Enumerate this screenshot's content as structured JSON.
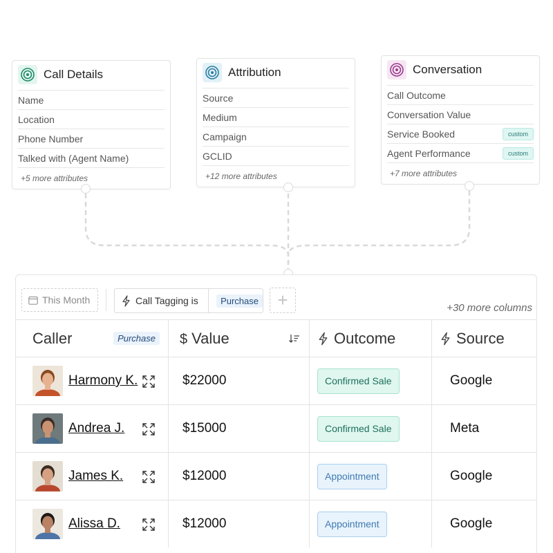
{
  "cards": [
    {
      "title": "Call Details",
      "icon": "target-icon",
      "icon_color": "#1f8a6a",
      "icon_bg": "#e3f6ee",
      "rows": [
        "Name",
        "Location",
        "Phone Number",
        "Talked with (Agent Name)"
      ],
      "more": "+5 more attributes"
    },
    {
      "title": "Attribution",
      "icon": "target-icon",
      "icon_color": "#2c7da0",
      "icon_bg": "#e1f1f8",
      "rows": [
        "Source",
        "Medium",
        "Campaign",
        "GCLID"
      ],
      "more": "+12 more attributes"
    },
    {
      "title": "Conversation",
      "icon": "target-icon",
      "icon_color": "#9b3b8e",
      "icon_bg": "#f6e6f3",
      "rows": [
        "Call Outcome",
        "Conversation Value",
        "Service Booked",
        "Agent Performance"
      ],
      "row_tags": [
        "",
        "",
        "custom",
        "custom"
      ],
      "more": "+7 more attributes"
    }
  ],
  "toolbar": {
    "date_filter": "This Month",
    "filter_label": "Call Tagging is",
    "filter_value": "Purchase",
    "add_button": "+",
    "more_columns": "+30 more columns"
  },
  "table": {
    "headers": {
      "caller": "Caller",
      "caller_tag": "Purchase",
      "value": "Value",
      "outcome": "Outcome",
      "source": "Source"
    },
    "rows": [
      {
        "caller": "Harmony K.",
        "value": "$22000",
        "outcome": "Confirmed Sale",
        "outcome_type": "sale",
        "source": "Google",
        "avatar_skin": "#e7b28f",
        "avatar_hair": "#8a4a22",
        "avatar_shirt": "#c4522a",
        "avatar_bg": "#ede5da"
      },
      {
        "caller": "Andrea J.",
        "value": "$15000",
        "outcome": "Confirmed Sale",
        "outcome_type": "sale",
        "source": "Meta",
        "avatar_skin": "#c99272",
        "avatar_hair": "#3a2c25",
        "avatar_shirt": "#4a6d8c",
        "avatar_bg": "#6e7a7c"
      },
      {
        "caller": "James K.",
        "value": "$12000",
        "outcome": "Appointment",
        "outcome_type": "appt",
        "source": "Google",
        "avatar_skin": "#d6a183",
        "avatar_hair": "#3b2a1f",
        "avatar_shirt": "#b84930",
        "avatar_bg": "#e4ddd2"
      },
      {
        "caller": "Alissa D.",
        "value": "$12000",
        "outcome": "Appointment",
        "outcome_type": "appt",
        "source": "Google",
        "avatar_skin": "#b98264",
        "avatar_hair": "#1f1815",
        "avatar_shirt": "#4f75a8",
        "avatar_bg": "#ece8e0"
      }
    ]
  },
  "colors": {
    "connector": "#d9d9d9",
    "sale_badge": "#dff7ef",
    "appt_badge": "#e8f3fc"
  }
}
